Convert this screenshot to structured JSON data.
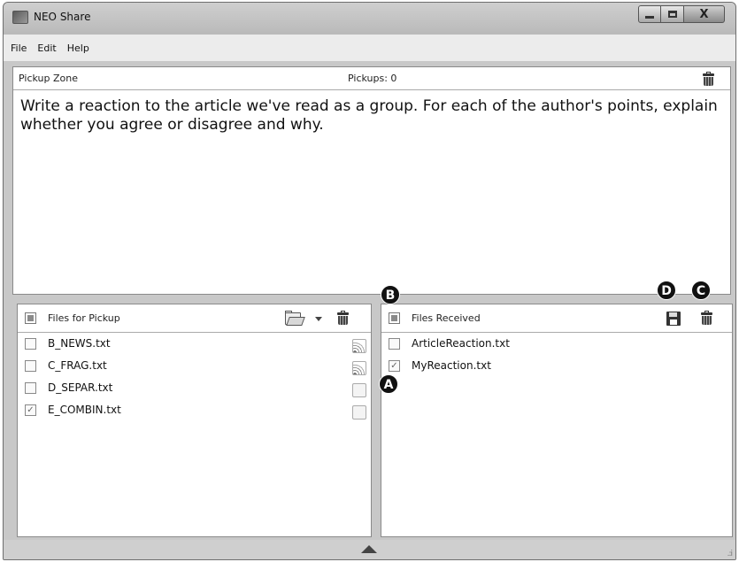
{
  "window": {
    "title": "NEO Share",
    "close_label": "X"
  },
  "menu": [
    "File",
    "Edit",
    "Help"
  ],
  "pickup_zone": {
    "title": "Pickup Zone",
    "pickups_label": "Pickups: 0",
    "text": "Write a reaction to the article we've read as a group. For each of the author's points, explain whether you agree or disagree and why."
  },
  "files_for_pickup": {
    "title": "Files for Pickup",
    "files": [
      {
        "name": "B_NEWS.txt",
        "checked": false,
        "status_icon": "signal-icon"
      },
      {
        "name": "C_FRAG.txt",
        "checked": false,
        "status_icon": "signal-icon"
      },
      {
        "name": "D_SEPAR.txt",
        "checked": false,
        "status_icon": "blank-status-icon"
      },
      {
        "name": "E_COMBIN.txt",
        "checked": true,
        "status_icon": "blank-status-icon"
      }
    ]
  },
  "files_received": {
    "title": "Files Received",
    "files": [
      {
        "name": "ArticleReaction.txt",
        "checked": false
      },
      {
        "name": "MyReaction.txt",
        "checked": true
      }
    ]
  },
  "callouts": {
    "a": "A",
    "b": "B",
    "c": "C",
    "d": "D"
  },
  "statusbar": {
    "grip": ".:i"
  }
}
